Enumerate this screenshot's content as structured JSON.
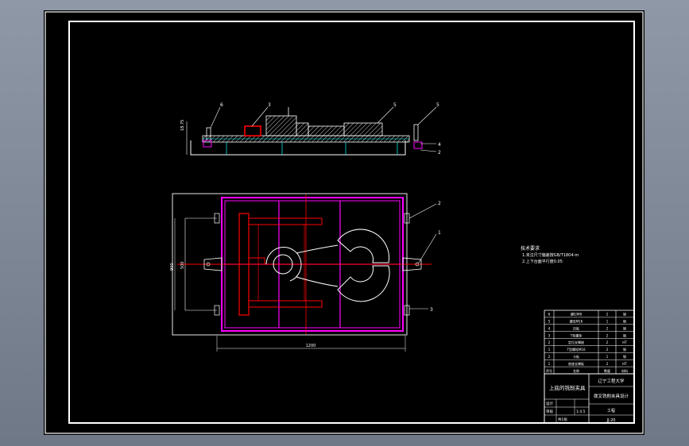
{
  "colors": {
    "background": "#000000",
    "frame": "#ffffff",
    "part": "#ff00ff",
    "cut": "#ff0000",
    "dim": "#ffffff",
    "hatch": "#ffffff"
  },
  "drawing": {
    "balloons_top": [
      "6",
      "3",
      "5",
      "5",
      "4",
      "2"
    ],
    "balloons_plan": [
      "2",
      "1",
      "3"
    ],
    "dim_top_left": "18.75",
    "dim_plan_width": "1200",
    "dim_plan_height": "900",
    "dim_plan_offset": "500"
  },
  "notes": {
    "title": "技术要求",
    "lines": [
      "1.未注尺寸偏差按GB/T1804-m",
      "2.上下台面平行度0.05"
    ]
  },
  "bom": {
    "rows": [
      [
        "6",
        "螺钉M8",
        "2",
        "钢"
      ],
      [
        "5",
        "螺母M16",
        "1",
        "钢"
      ],
      [
        "4",
        "压板",
        "2",
        "钢"
      ],
      [
        "3",
        "T型螺栓",
        "2",
        "钢"
      ],
      [
        "2",
        "定位支撑座",
        "2",
        "HT"
      ],
      [
        "1",
        "T型螺栓M16",
        "2",
        "钢"
      ],
      [
        "2",
        "卡板",
        "1",
        "钢"
      ],
      [
        "1",
        "底座支撑板",
        "2",
        "HT"
      ]
    ],
    "header": [
      "序号",
      "名称",
      "数量",
      "材料"
    ]
  },
  "titleblock": {
    "drawing_name": "上底的铣削夹具",
    "school": "辽宁工程大学",
    "part_name": "拨叉铣削夹具设计",
    "designer_label": "设计",
    "checker_label": "审核",
    "scale": "1:4.5",
    "sheet_label": "共1张",
    "drawing_no": "JJ-20",
    "sub_caption": "工程"
  }
}
